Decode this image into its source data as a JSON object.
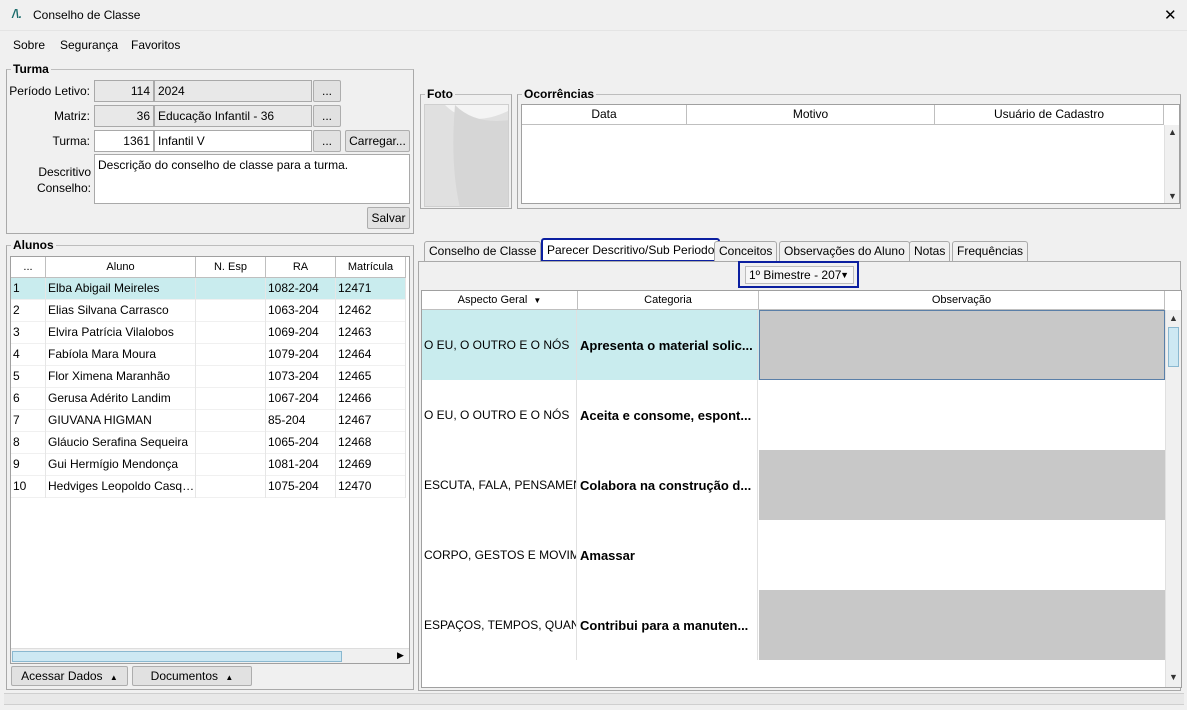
{
  "window": {
    "title": "Conselho de Classe",
    "close": "✕",
    "logo": "/\\."
  },
  "menu": [
    "Sobre",
    "Segurança",
    "Favoritos"
  ],
  "turma": {
    "legend": "Turma",
    "periodo_label": "Período Letivo:",
    "periodo_code": "114",
    "periodo_value": "2024",
    "matriz_label": "Matriz:",
    "matriz_code": "36",
    "matriz_value": "Educação Infantil - 36",
    "turma_label": "Turma:",
    "turma_code": "1361",
    "turma_value": "Infantil V",
    "dots": "...",
    "carregar": "Carregar...",
    "descritivo_label1": "Descritivo",
    "descritivo_label2": "Conselho:",
    "descritivo_value": "Descrição do conselho de classe para a turma.",
    "salvar": "Salvar"
  },
  "foto": {
    "legend": "Foto"
  },
  "ocorrencias": {
    "legend": "Ocorrências",
    "columns": [
      "Data",
      "Motivo",
      "Usuário de Cadastro"
    ]
  },
  "alunos": {
    "legend": "Alunos",
    "columns": [
      "...",
      "Aluno",
      "N. Esp",
      "RA",
      "Matrícula"
    ],
    "rows": [
      {
        "n": "1",
        "nome": "Elba Abigail Meireles",
        "esp": "",
        "ra": "1082-204",
        "mat": "12471"
      },
      {
        "n": "2",
        "nome": "Elias Silvana Carrasco",
        "esp": "",
        "ra": "1063-204",
        "mat": "12462"
      },
      {
        "n": "3",
        "nome": "Elvira Patrícia Vilalobos",
        "esp": "",
        "ra": "1069-204",
        "mat": "12463"
      },
      {
        "n": "4",
        "nome": "Fabíola Mara Moura",
        "esp": "",
        "ra": "1079-204",
        "mat": "12464"
      },
      {
        "n": "5",
        "nome": "Flor Ximena Maranhão",
        "esp": "",
        "ra": "1073-204",
        "mat": "12465"
      },
      {
        "n": "6",
        "nome": "Gerusa Adérito Landim",
        "esp": "",
        "ra": "1067-204",
        "mat": "12466"
      },
      {
        "n": "7",
        "nome": "GIUVANA HIGMAN",
        "esp": "",
        "ra": "85-204",
        "mat": "12467"
      },
      {
        "n": "8",
        "nome": "Gláucio Serafina Sequeira",
        "esp": "",
        "ra": "1065-204",
        "mat": "12468"
      },
      {
        "n": "9",
        "nome": "Gui Hermígio Mendonça",
        "esp": "",
        "ra": "1081-204",
        "mat": "12469"
      },
      {
        "n": "10",
        "nome": "Hedviges Leopoldo Casqu...",
        "esp": "",
        "ra": "1075-204",
        "mat": "12470"
      }
    ],
    "acessar": "Acessar Dados",
    "documentos": "Documentos"
  },
  "tabs": [
    "Conselho de Classe",
    "Parecer Descritivo/Sub Periodo",
    "Conceitos",
    "Observações do Aluno",
    "Notas",
    "Frequências"
  ],
  "periodo_select": "1º Bimestre - 207",
  "parecer": {
    "columns": [
      "Aspecto Geral",
      "Categoria",
      "Observação"
    ],
    "rows": [
      {
        "aspecto": "O EU, O OUTRO E O NÓS",
        "categoria": "Apresenta o material solic...",
        "shade": "selected"
      },
      {
        "aspecto": "O EU, O OUTRO E O NÓS",
        "categoria": "Aceita e consome, espont...",
        "shade": "white"
      },
      {
        "aspecto": "ESCUTA, FALA, PENSAMEN...",
        "categoria": "Colabora na construção d...",
        "shade": "gray"
      },
      {
        "aspecto": "CORPO, GESTOS E MOVIM...",
        "categoria": "Amassar",
        "shade": "white"
      },
      {
        "aspecto": "ESPAÇOS, TEMPOS, QUAN...",
        "categoria": "Contribui para a manuten...",
        "shade": "gray"
      }
    ]
  }
}
